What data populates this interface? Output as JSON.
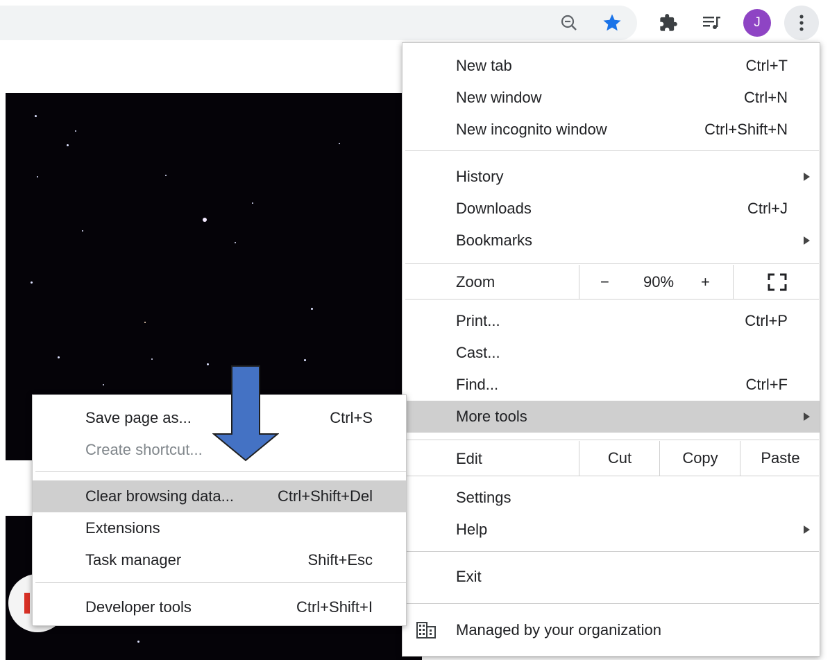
{
  "toolbar": {
    "icons": [
      "zoom-out-icon",
      "bookmark-star-icon",
      "extensions-puzzle-icon",
      "media-playlist-icon"
    ],
    "avatar_letter": "J",
    "menu_icon": "three-dots-vertical-icon",
    "star_color": "#1a73e8",
    "avatar_color": "#8e44c4"
  },
  "main_menu": {
    "new_tab": {
      "label": "New tab",
      "shortcut": "Ctrl+T"
    },
    "new_window": {
      "label": "New window",
      "shortcut": "Ctrl+N"
    },
    "new_incognito": {
      "label": "New incognito window",
      "shortcut": "Ctrl+Shift+N"
    },
    "history": {
      "label": "History"
    },
    "downloads": {
      "label": "Downloads",
      "shortcut": "Ctrl+J"
    },
    "bookmarks": {
      "label": "Bookmarks"
    },
    "zoom": {
      "label": "Zoom",
      "minus": "−",
      "value": "90%",
      "plus": "+",
      "fullscreen_icon": "fullscreen-icon"
    },
    "print": {
      "label": "Print...",
      "shortcut": "Ctrl+P"
    },
    "cast": {
      "label": "Cast..."
    },
    "find": {
      "label": "Find...",
      "shortcut": "Ctrl+F"
    },
    "more_tools": {
      "label": "More tools"
    },
    "edit": {
      "label": "Edit",
      "cut": "Cut",
      "copy": "Copy",
      "paste": "Paste"
    },
    "settings": {
      "label": "Settings"
    },
    "help": {
      "label": "Help"
    },
    "exit": {
      "label": "Exit"
    },
    "managed": {
      "label": "Managed by your organization",
      "icon": "building-icon"
    }
  },
  "more_tools_submenu": {
    "save_page": {
      "label": "Save page as...",
      "shortcut": "Ctrl+S"
    },
    "create_shortcut": {
      "label": "Create shortcut..."
    },
    "clear_browsing": {
      "label": "Clear browsing data...",
      "shortcut": "Ctrl+Shift+Del"
    },
    "extensions": {
      "label": "Extensions"
    },
    "task_manager": {
      "label": "Task manager",
      "shortcut": "Shift+Esc"
    },
    "developer_tools": {
      "label": "Developer tools",
      "shortcut": "Ctrl+Shift+I"
    }
  },
  "annotation": {
    "arrow_color": "#4472c4",
    "icon": "down-arrow-icon"
  }
}
